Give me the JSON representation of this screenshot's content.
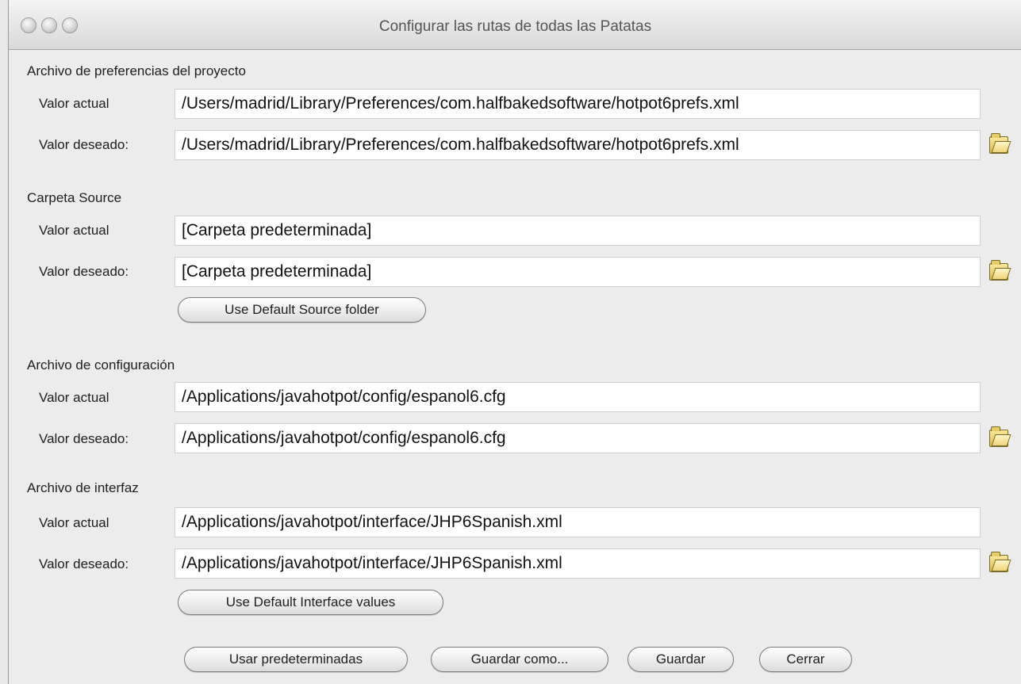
{
  "window": {
    "title": "Configurar las rutas de todas las Patatas"
  },
  "sections": {
    "prefs": {
      "label": "Archivo de preferencias del proyecto",
      "current_label": "Valor actual",
      "current_value": "/Users/madrid/Library/Preferences/com.halfbakedsoftware/hotpot6prefs.xml",
      "desired_label": "Valor deseado:",
      "desired_value": "/Users/madrid/Library/Preferences/com.halfbakedsoftware/hotpot6prefs.xml"
    },
    "source": {
      "label": "Carpeta Source",
      "current_label": "Valor actual",
      "current_value": "[Carpeta predeterminada]",
      "desired_label": "Valor deseado:",
      "desired_value": "[Carpeta predeterminada]",
      "default_button": "Use Default Source folder"
    },
    "config": {
      "label": "Archivo de configuración",
      "current_label": "Valor actual",
      "current_value": "/Applications/javahotpot/config/espanol6.cfg",
      "desired_label": "Valor deseado:",
      "desired_value": "/Applications/javahotpot/config/espanol6.cfg"
    },
    "interface": {
      "label": "Archivo de interfaz",
      "current_label": "Valor actual",
      "current_value": "/Applications/javahotpot/interface/JHP6Spanish.xml",
      "desired_label": "Valor deseado:",
      "desired_value": "/Applications/javahotpot/interface/JHP6Spanish.xml",
      "default_button": "Use Default Interface values"
    }
  },
  "footer": {
    "defaults_button": "Usar predeterminadas",
    "save_as_button": "Guardar como...",
    "save_button": "Guardar",
    "close_button": "Cerrar"
  },
  "icons": {
    "browse": "open-folder-icon",
    "window_controls": [
      "close-icon",
      "minimize-icon",
      "zoom-icon"
    ]
  }
}
